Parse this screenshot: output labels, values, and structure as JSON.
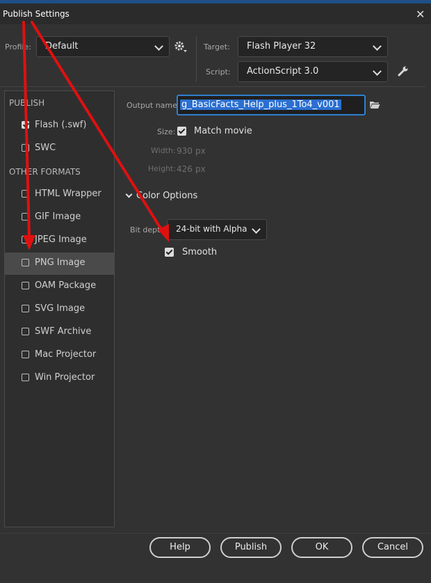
{
  "window": {
    "title": "Publish Settings"
  },
  "header": {
    "profile_label": "Profile:",
    "profile_value": "Default",
    "target_label": "Target:",
    "target_value": "Flash Player 32",
    "script_label": "Script:",
    "script_value": "ActionScript 3.0"
  },
  "sidebar": {
    "publish_heading": "PUBLISH",
    "other_heading": "OTHER FORMATS",
    "publish_items": [
      {
        "label": "Flash (.swf)",
        "checked": true
      },
      {
        "label": "SWC",
        "checked": false
      }
    ],
    "other_items": [
      {
        "label": "HTML Wrapper",
        "checked": false
      },
      {
        "label": "GIF Image",
        "checked": false
      },
      {
        "label": "JPEG Image",
        "checked": false
      },
      {
        "label": "PNG Image",
        "checked": false,
        "selected": true
      },
      {
        "label": "OAM Package",
        "checked": false
      },
      {
        "label": "SVG Image",
        "checked": false
      },
      {
        "label": "SWF Archive",
        "checked": false
      },
      {
        "label": "Mac Projector",
        "checked": false
      },
      {
        "label": "Win Projector",
        "checked": false
      }
    ]
  },
  "main": {
    "output_label": "Output name:",
    "output_value": "g_BasicFacts_Help_plus_1To4_v001",
    "size_label": "Size:",
    "match_movie_label": "Match movie",
    "match_movie_checked": true,
    "width_label": "Width:",
    "width_value": "930",
    "height_label": "Height:",
    "height_value": "426",
    "unit": "px",
    "color_options_label": "Color Options",
    "bit_depth_label": "Bit depth:",
    "bit_depth_value": "24-bit with Alpha",
    "smooth_label": "Smooth",
    "smooth_checked": true
  },
  "footer": {
    "help": "Help",
    "publish": "Publish",
    "ok": "OK",
    "cancel": "Cancel"
  },
  "colors": {
    "background": "#323232",
    "accent": "#2f80d0",
    "annotation_arrow": "#e01010"
  },
  "icons": [
    "close-icon",
    "gear-icon",
    "wrench-icon",
    "folder-icon",
    "chevron-down-icon"
  ]
}
